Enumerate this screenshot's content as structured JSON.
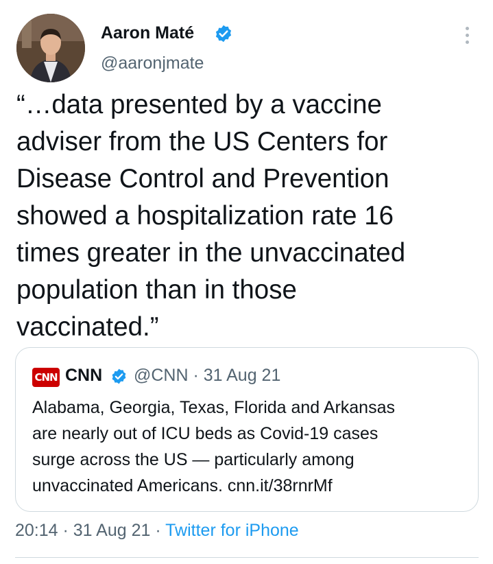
{
  "author": {
    "name": "Aaron Maté",
    "handle": "@aaronjmate",
    "verified_icon": "verified-badge-icon"
  },
  "tweet": {
    "lines": [
      "“…data presented by a vaccine",
      "adviser from the US Centers for",
      "Disease Control and Prevention",
      "showed a hospitalization rate 16",
      "times greater in the unvaccinated",
      "population than in those",
      "vaccinated.”"
    ]
  },
  "quote": {
    "logo_text": "CNN",
    "name": "CNN",
    "meta": "@CNN · 31 Aug 21",
    "lines": [
      "Alabama, Georgia, Texas, Florida and Arkansas",
      "are nearly out of ICU beds as Covid-19 cases",
      "surge across the US — particularly among",
      "unvaccinated Americans. cnn.it/38rnrMf"
    ]
  },
  "footer": {
    "timestamp": "20:14 · 31 Aug 21 · ",
    "source": "Twitter for iPhone"
  },
  "colors": {
    "accent": "#1d9bf0",
    "secondary_text": "#536471",
    "cnn_red": "#cc0000",
    "border": "#cfd9de"
  }
}
